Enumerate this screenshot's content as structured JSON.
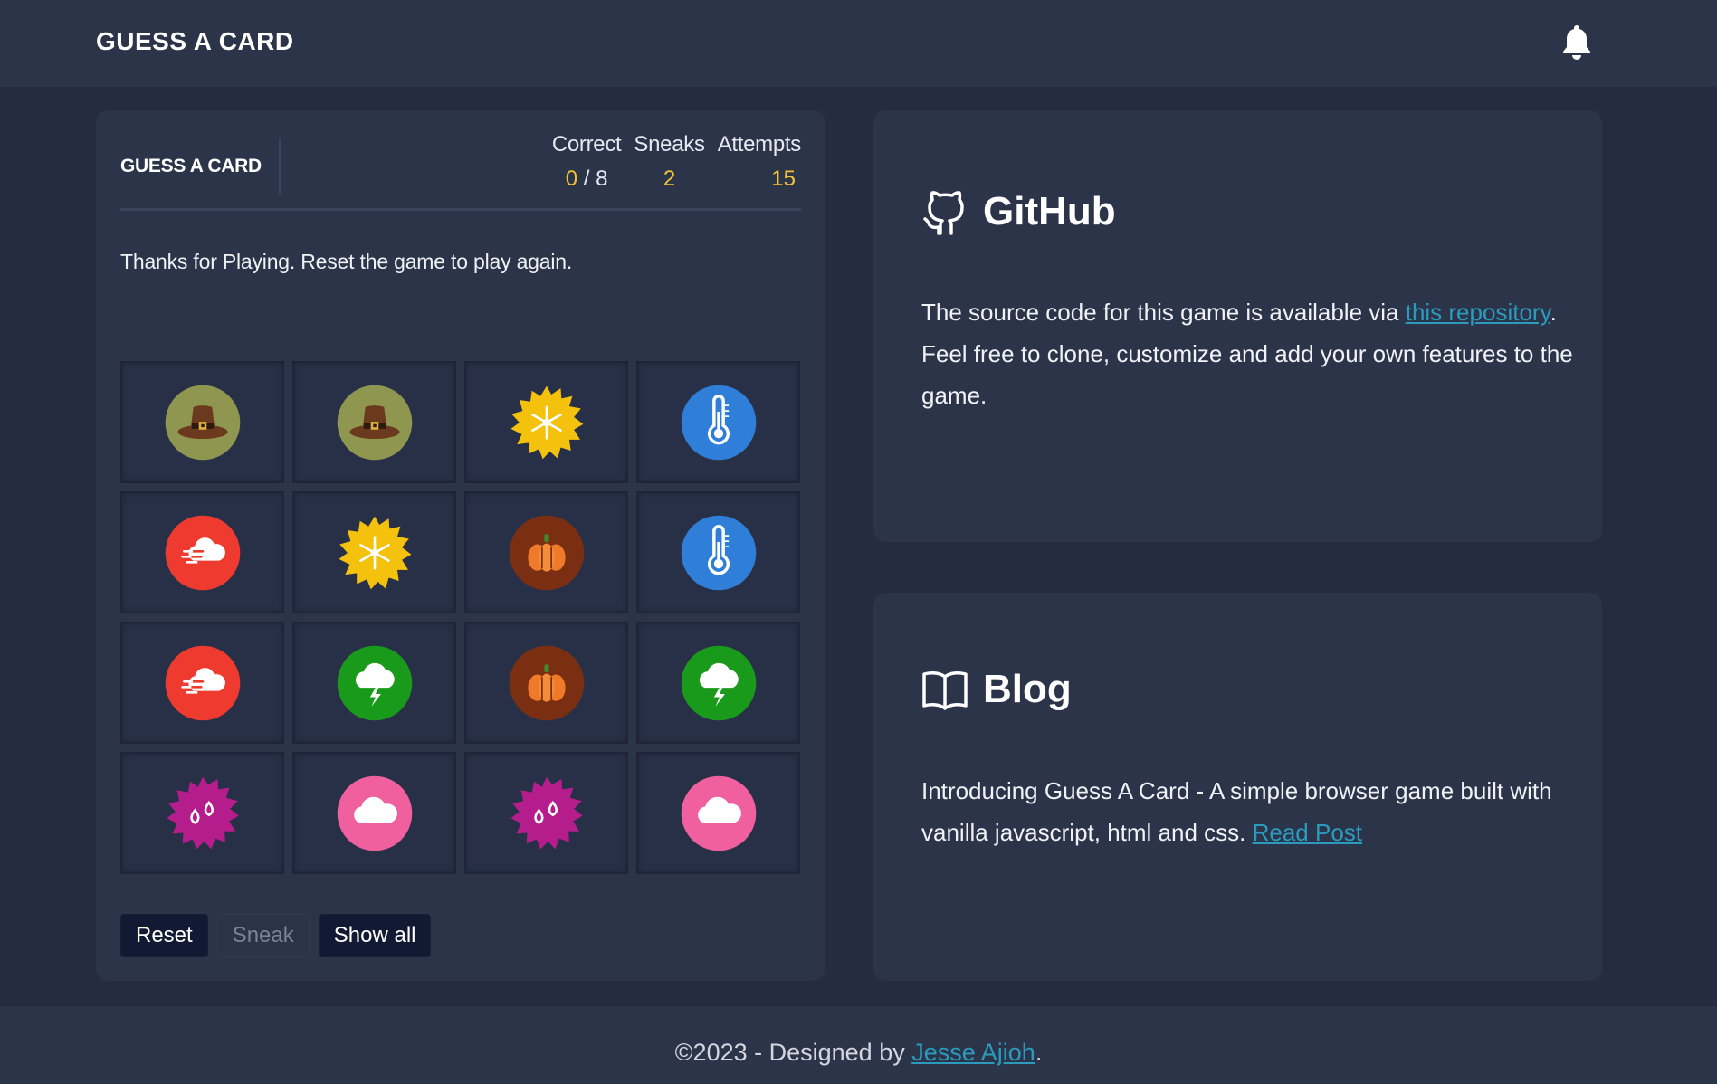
{
  "navbar": {
    "brand": "GUESS A CARD",
    "notification_icon": "bell-icon"
  },
  "game": {
    "title": "GUESS A CARD",
    "stats": {
      "correct_label": "Correct",
      "correct_value": "0",
      "correct_sep": " / ",
      "correct_total": "8",
      "sneaks_label": "Sneaks",
      "sneaks_value": "2",
      "attempts_label": "Attempts",
      "attempts_value": "15"
    },
    "message": "Thanks for Playing. Reset the game to play again.",
    "tiles": [
      "pilgrim-hat",
      "pilgrim-hat",
      "snowflake",
      "thermometer",
      "wind-cloud",
      "snowflake",
      "pumpkin",
      "thermometer",
      "wind-cloud",
      "storm-cloud",
      "pumpkin",
      "storm-cloud",
      "raindrops",
      "cloud",
      "raindrops",
      "cloud"
    ],
    "buttons": {
      "reset": "Reset",
      "sneak": "Sneak",
      "show_all": "Show all"
    }
  },
  "github": {
    "icon": "github-icon",
    "heading": "GitHub",
    "text_before": "The source code for this game is available via ",
    "link_text": "this repository",
    "text_after": ". Feel free to clone, customize and add your own features to the game."
  },
  "blog": {
    "icon": "book-icon",
    "heading": "Blog",
    "text_before": "Introducing Guess A Card - A simple browser game built with vanilla javascript, html and css. ",
    "link_text": "Read Post"
  },
  "footer": {
    "text_before": "©2023 - Designed by ",
    "link_text": "Jesse Ajioh",
    "text_after": "."
  },
  "colors": {
    "background": "#252c40",
    "panel": "#2c344a",
    "accent_yellow": "#f2c233",
    "link": "#2a9bbd",
    "button_dark": "#121a33"
  }
}
